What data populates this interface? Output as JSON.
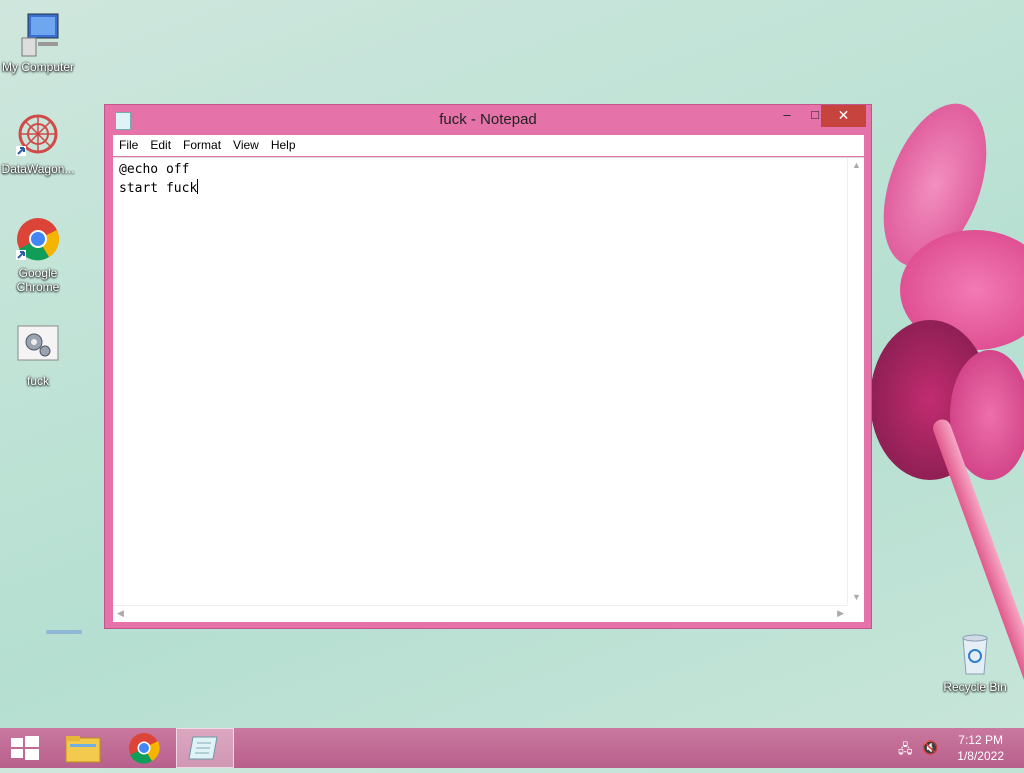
{
  "desktop": {
    "icons": [
      {
        "label": "My Computer"
      },
      {
        "label": "DataWagon..."
      },
      {
        "label": "Google Chrome"
      },
      {
        "label": "fuck"
      },
      {
        "label": "Recycle Bin"
      }
    ]
  },
  "notepad": {
    "title": "fuck - Notepad",
    "menu": [
      "File",
      "Edit",
      "Format",
      "View",
      "Help"
    ],
    "content_lines": [
      "@echo off",
      "start fuck"
    ],
    "controls": {
      "minimize": "–",
      "maximize": "□",
      "close": "✕"
    }
  },
  "taskbar": {
    "clock_time": "7:12 PM",
    "clock_date": "1/8/2022"
  },
  "colors": {
    "window_frame": "#e573a9",
    "close_button": "#c7443e",
    "taskbar": "#c06b94"
  }
}
